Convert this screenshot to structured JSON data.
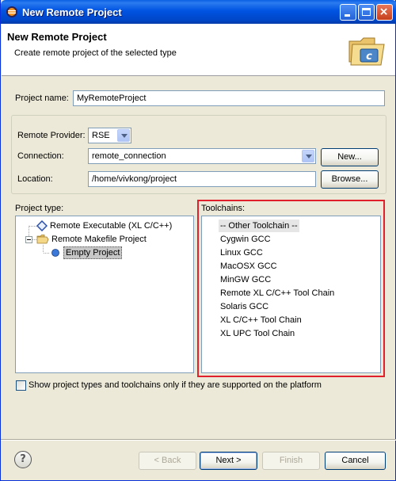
{
  "window": {
    "title": "New Remote Project"
  },
  "banner": {
    "title": "New Remote Project",
    "subtitle": "Create remote project of the selected type"
  },
  "project_name": {
    "label": "Project name:",
    "value": "MyRemoteProject"
  },
  "remote": {
    "provider_label": "Remote Provider:",
    "provider_value": "RSE",
    "connection_label": "Connection:",
    "connection_value": "remote_connection",
    "new_button": "New...",
    "location_label": "Location:",
    "location_value": "/home/vivkong/project",
    "browse_button": "Browse..."
  },
  "project_type": {
    "label": "Project type:",
    "items": [
      "Remote Executable (XL C/C++)",
      "Remote Makefile Project",
      "Empty Project"
    ]
  },
  "toolchains": {
    "label": "Toolchains:",
    "items": [
      "-- Other Toolchain --",
      "Cygwin GCC",
      "Linux GCC",
      "MacOSX GCC",
      "MinGW GCC",
      "Remote XL C/C++ Tool Chain",
      "Solaris GCC",
      "XL C/C++ Tool Chain",
      "XL UPC Tool Chain"
    ]
  },
  "show_supported": {
    "label": "Show project types and toolchains only if they are supported on the platform",
    "checked": false
  },
  "footer": {
    "help": "?",
    "back": "< Back",
    "next": "Next >",
    "finish": "Finish",
    "cancel": "Cancel"
  },
  "colors": {
    "title_bar": "#0053e1",
    "highlight_box": "#e0202a",
    "selection": "#c7c7c7"
  }
}
